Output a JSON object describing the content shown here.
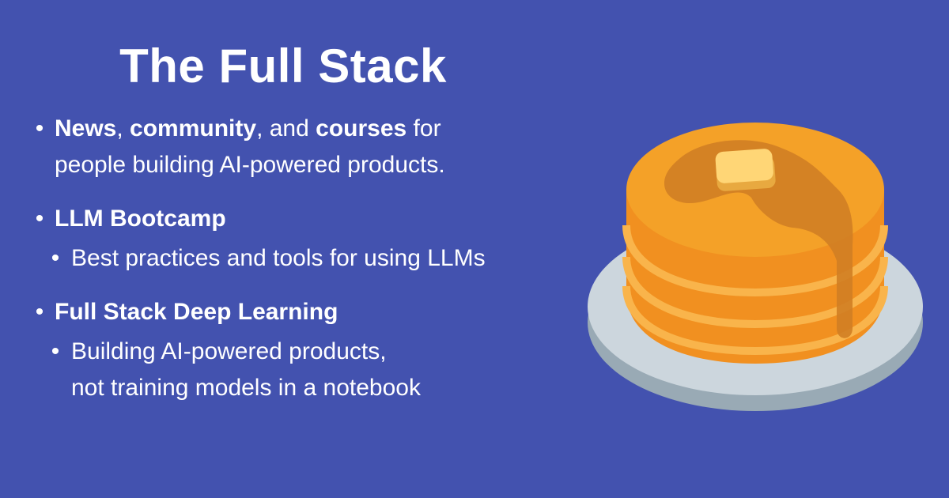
{
  "title": "The Full Stack",
  "bullet1": {
    "bold1": "News",
    "text1": ", ",
    "bold2": "community",
    "text2": ", and ",
    "bold3": "courses",
    "text3": " for",
    "line2": "people building AI-powered products."
  },
  "bullet2": {
    "label": "LLM Bootcamp",
    "sub": "Best practices and tools for using LLMs"
  },
  "bullet3": {
    "label": "Full Stack Deep Learning",
    "sub_line1": "Building AI-powered products,",
    "sub_line2": "not training models in a notebook"
  },
  "bullet_glyph": "•",
  "colors": {
    "background": "#4352AF",
    "text": "#FFFFFF",
    "pancake": "#F4A128",
    "syrup": "#D47E25",
    "butter": "#FFD676",
    "plate": "#CCD6DD"
  },
  "illustration_icon": "pancakes-icon"
}
